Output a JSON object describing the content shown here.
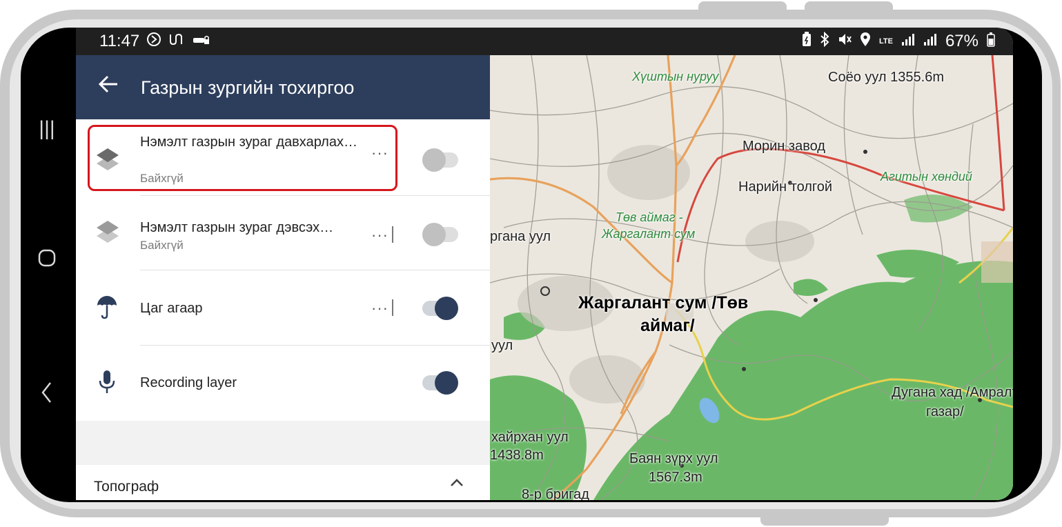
{
  "status_bar": {
    "time": "11:47",
    "battery": "67%",
    "network": "LTE",
    "left_icons": [
      "do-not-disturb-icon",
      "route-icon",
      "car-lock-icon"
    ],
    "right_icons": [
      "battery-saver-icon",
      "bluetooth-icon",
      "mute-icon",
      "location-icon",
      "signal-icon",
      "signal-icon",
      "battery-icon"
    ]
  },
  "app_bar": {
    "title": "Газрын зургийн тохиргоо",
    "back_icon": "back-arrow-icon"
  },
  "layers": [
    {
      "title": "Нэмэлт газрын зураг давхарлах…",
      "subtitle": "Байхгүй",
      "icon": "layers-icon",
      "enabled": false,
      "highlighted": true
    },
    {
      "title": "Нэмэлт газрын зураг дэвсэх…",
      "subtitle": "Байхгүй",
      "icon": "layers-icon",
      "enabled": false,
      "highlighted": false
    },
    {
      "title": "Цаг агаар",
      "subtitle": "",
      "icon": "umbrella-icon",
      "enabled": true,
      "highlighted": false
    },
    {
      "title": "Recording layer",
      "subtitle": "",
      "icon": "microphone-icon",
      "enabled": true,
      "highlighted": false
    }
  ],
  "section": {
    "title": "Топограф",
    "expanded": true
  },
  "map": {
    "labels": [
      {
        "text": "Хүштын нуруу",
        "style": "green"
      },
      {
        "text": "Соёо уул 1355.6m",
        "style": "normal"
      },
      {
        "text": "Морин завод",
        "style": "normal"
      },
      {
        "text": "Нарийн толгой",
        "style": "normal"
      },
      {
        "text": "Агитын хөндий",
        "style": "green"
      },
      {
        "text": "Төв аймаг -",
        "style": "green"
      },
      {
        "text": "Жаргалант сум",
        "style": "green"
      },
      {
        "text": "ргана уул",
        "style": "normal"
      },
      {
        "text": "Жаргалант сум /Төв",
        "style": "big"
      },
      {
        "text": "аймаг/",
        "style": "big"
      },
      {
        "text": "уул",
        "style": "normal"
      },
      {
        "text": "Дугана хад /Амралт",
        "style": "normal"
      },
      {
        "text": "газар/",
        "style": "normal"
      },
      {
        "text": "хайрхан уул",
        "style": "normal"
      },
      {
        "text": "1438.8m",
        "style": "normal"
      },
      {
        "text": "Баян зүрх уул",
        "style": "normal"
      },
      {
        "text": "1567.3m",
        "style": "normal"
      },
      {
        "text": "8-р бригад",
        "style": "normal"
      }
    ]
  },
  "colors": {
    "app_bar": "#2d3e5c",
    "toggle_on": "#2d3e5c",
    "highlight_border": "#d7151c",
    "forest": "#5cb35a",
    "main_road": "#e8a25c",
    "red_road": "#d7473d",
    "yellow_road": "#e8d14c",
    "water": "#7fb7e6"
  }
}
